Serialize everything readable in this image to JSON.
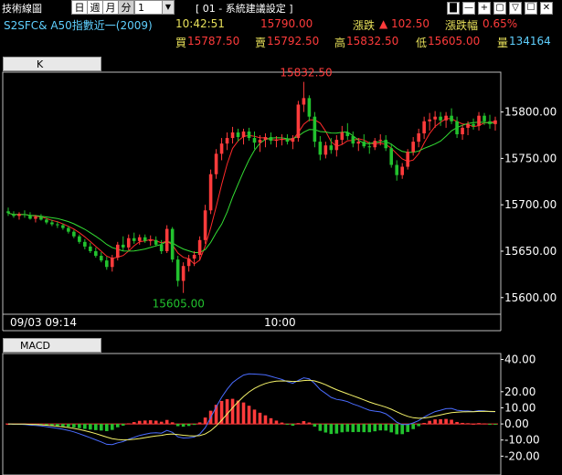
{
  "toolbar": {
    "title": "技術線圖",
    "periods": [
      "日",
      "週",
      "月",
      "分"
    ],
    "interval_value": "1",
    "setting_label": "[ 01 - 系統建議設定 ]",
    "window_buttons": [
      "▇",
      "—",
      "+",
      "▢",
      "▽",
      "☐",
      "✕"
    ]
  },
  "quote": {
    "symbol": "S2SFC& A50指數近一(2009)",
    "time": "10:42:51",
    "last": "15790.00",
    "change_label": "漲跌",
    "change_arrow": "▲",
    "change": "102.50",
    "change_pct_label": "漲跌幅",
    "change_pct": "0.65%",
    "bid_label": "買",
    "bid": "15787.50",
    "ask_label": "賣",
    "ask": "15792.50",
    "high_label": "高",
    "high": "15832.50",
    "low_label": "低",
    "low": "15605.00",
    "volume_label": "量",
    "volume": "134164"
  },
  "colors": {
    "up": "#ff3b3b",
    "down": "#22c22e",
    "ma_fast": "#ff2a2a",
    "ma_slow": "#33dd33",
    "macd_dif": "#4a6cff",
    "macd_signal": "#f5f36a",
    "zero_line": "#ff3b3b",
    "gold": "#e8e05a",
    "cyan": "#5fd0ff"
  },
  "chart_data": [
    {
      "type": "candlestick",
      "title": "K",
      "x_start_label": "09/03 09:14",
      "x_mid_label": "10:00",
      "ylim": [
        15585,
        15840
      ],
      "yticks": [
        "15800.00",
        "15750.00",
        "15700.00",
        "15650.00",
        "15600.00"
      ],
      "high_annotation": "15832.50",
      "low_annotation": "15605.00",
      "candles": [
        [
          15693,
          15697,
          15688,
          15691
        ],
        [
          15690,
          15693,
          15686,
          15688
        ],
        [
          15688,
          15692,
          15684,
          15690
        ],
        [
          15690,
          15694,
          15686,
          15689
        ],
        [
          15689,
          15692,
          15684,
          15685
        ],
        [
          15685,
          15689,
          15681,
          15687
        ],
        [
          15687,
          15690,
          15683,
          15684
        ],
        [
          15684,
          15686,
          15679,
          15681
        ],
        [
          15681,
          15684,
          15677,
          15679
        ],
        [
          15679,
          15682,
          15675,
          15678
        ],
        [
          15678,
          15680,
          15673,
          15675
        ],
        [
          15675,
          15677,
          15669,
          15671
        ],
        [
          15671,
          15673,
          15664,
          15666
        ],
        [
          15666,
          15668,
          15658,
          15660
        ],
        [
          15660,
          15663,
          15652,
          15655
        ],
        [
          15655,
          15659,
          15648,
          15650
        ],
        [
          15650,
          15654,
          15643,
          15645
        ],
        [
          15645,
          15649,
          15638,
          15640
        ],
        [
          15640,
          15644,
          15630,
          15633
        ],
        [
          15633,
          15646,
          15628,
          15643
        ],
        [
          15643,
          15660,
          15640,
          15657
        ],
        [
          15657,
          15666,
          15650,
          15654
        ],
        [
          15654,
          15668,
          15651,
          15664
        ],
        [
          15664,
          15670,
          15658,
          15661
        ],
        [
          15661,
          15668,
          15657,
          15665
        ],
        [
          15665,
          15668,
          15659,
          15661
        ],
        [
          15661,
          15667,
          15656,
          15662
        ],
        [
          15662,
          15666,
          15655,
          15657
        ],
        [
          15657,
          15662,
          15647,
          15650
        ],
        [
          15650,
          15678,
          15648,
          15674
        ],
        [
          15674,
          15676,
          15638,
          15641
        ],
        [
          15641,
          15645,
          15612,
          15618
        ],
        [
          15618,
          15638,
          15605,
          15634
        ],
        [
          15634,
          15646,
          15628,
          15642
        ],
        [
          15642,
          15650,
          15634,
          15646
        ],
        [
          15646,
          15666,
          15640,
          15662
        ],
        [
          15662,
          15700,
          15658,
          15694
        ],
        [
          15694,
          15738,
          15690,
          15733
        ],
        [
          15733,
          15760,
          15728,
          15755
        ],
        [
          15755,
          15772,
          15748,
          15766
        ],
        [
          15766,
          15778,
          15759,
          15772
        ],
        [
          15772,
          15784,
          15766,
          15778
        ],
        [
          15778,
          15782,
          15768,
          15773
        ],
        [
          15773,
          15782,
          15765,
          15779
        ],
        [
          15779,
          15783,
          15769,
          15772
        ],
        [
          15772,
          15779,
          15760,
          15767
        ],
        [
          15767,
          15775,
          15757,
          15770
        ],
        [
          15770,
          15777,
          15762,
          15773
        ],
        [
          15773,
          15778,
          15765,
          15769
        ],
        [
          15769,
          15774,
          15762,
          15770
        ],
        [
          15770,
          15776,
          15764,
          15771
        ],
        [
          15771,
          15776,
          15765,
          15768
        ],
        [
          15768,
          15775,
          15760,
          15772
        ],
        [
          15772,
          15812,
          15768,
          15808
        ],
        [
          15808,
          15832.5,
          15800,
          15815
        ],
        [
          15815,
          15818,
          15790,
          15795
        ],
        [
          15795,
          15800,
          15762,
          15768
        ],
        [
          15768,
          15774,
          15748,
          15754
        ],
        [
          15754,
          15768,
          15750,
          15764
        ],
        [
          15764,
          15772,
          15755,
          15759
        ],
        [
          15759,
          15775,
          15752,
          15770
        ],
        [
          15770,
          15785,
          15765,
          15778
        ],
        [
          15778,
          15788,
          15770,
          15774
        ],
        [
          15774,
          15779,
          15762,
          15766
        ],
        [
          15766,
          15772,
          15758,
          15768
        ],
        [
          15768,
          15776,
          15761,
          15763
        ],
        [
          15763,
          15768,
          15755,
          15762
        ],
        [
          15762,
          15772,
          15759,
          15769
        ],
        [
          15769,
          15776,
          15764,
          15770
        ],
        [
          15770,
          15775,
          15758,
          15761
        ],
        [
          15761,
          15766,
          15740,
          15743
        ],
        [
          15743,
          15748,
          15726,
          15732
        ],
        [
          15732,
          15745,
          15728,
          15741
        ],
        [
          15741,
          15760,
          15738,
          15757
        ],
        [
          15757,
          15773,
          15753,
          15768
        ],
        [
          15768,
          15782,
          15762,
          15777
        ],
        [
          15777,
          15795,
          15771,
          15790
        ],
        [
          15790,
          15799,
          15780,
          15792
        ],
        [
          15792,
          15801,
          15783,
          15795
        ],
        [
          15795,
          15800,
          15785,
          15791
        ],
        [
          15791,
          15800,
          15783,
          15796
        ],
        [
          15796,
          15804,
          15787,
          15790
        ],
        [
          15790,
          15795,
          15772,
          15776
        ],
        [
          15776,
          15786,
          15770,
          15783
        ],
        [
          15783,
          15790,
          15775,
          15787
        ],
        [
          15787,
          15793,
          15781,
          15785
        ],
        [
          15785,
          15800,
          15780,
          15796
        ],
        [
          15796,
          15799,
          15786,
          15790
        ],
        [
          15790,
          15797,
          15782,
          15787
        ],
        [
          15787,
          15795,
          15780,
          15791
        ]
      ]
    },
    {
      "type": "macd",
      "title": "MACD",
      "ylim": [
        -30,
        42
      ],
      "yticks": [
        "40.00",
        "20.00",
        "10.00",
        "0.00",
        "-10.00",
        "-20.00"
      ]
    }
  ]
}
